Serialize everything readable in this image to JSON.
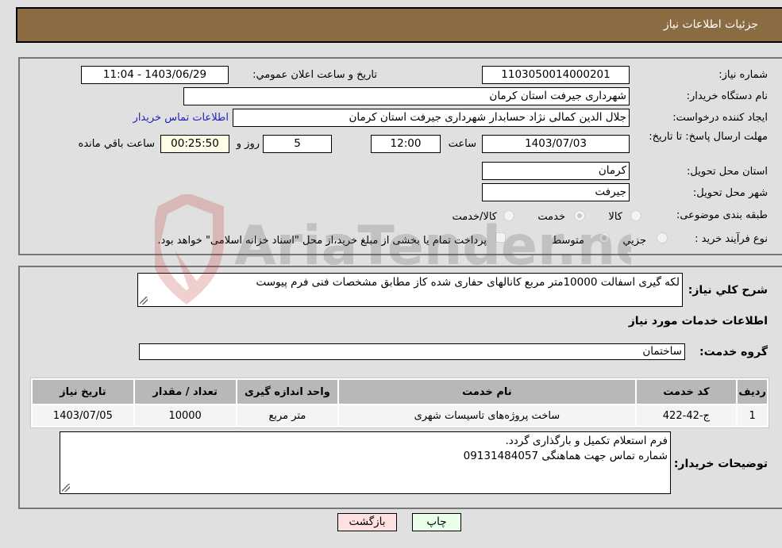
{
  "header": {
    "title": "جزئیات اطلاعات نیاز"
  },
  "form": {
    "need_number": {
      "label": "شماره نیاز:",
      "value": "1103050014000201"
    },
    "announce_datetime": {
      "label": "تاریخ و ساعت اعلان عمومي:",
      "value": "1403/06/29 - 11:04"
    },
    "buyer_org": {
      "label": "نام دستگاه خریدار:",
      "value": "شهرداری جیرفت استان کرمان"
    },
    "requester": {
      "label": "ایجاد کننده درخواست:",
      "value": "جلال الدین کمالی نژاد حسابدار شهرداری جیرفت استان کرمان"
    },
    "buyer_contact_link": "اطلاعات تماس خریدار",
    "deadline": {
      "label": "مهلت ارسال پاسخ: تا تاریخ:",
      "date": "1403/07/03",
      "time_label": "ساعت",
      "time": "12:00",
      "days": "5",
      "days_label": "روز و",
      "remaining": "00:25:50",
      "remaining_label": "ساعت باقي مانده"
    },
    "province": {
      "label": "استان محل تحویل:",
      "value": "کرمان"
    },
    "city": {
      "label": "شهر محل تحویل:",
      "value": "جیرفت"
    },
    "category": {
      "label": "طبقه بندی موضوعی:",
      "options": [
        "کالا",
        "خدمت",
        "کالا/خدمت"
      ],
      "selected": "خدمت"
    },
    "purchase_type": {
      "label": "نوع فرآیند خرید :",
      "options": [
        "جزيي",
        "متوسط"
      ],
      "selected": "متوسط",
      "treasury_note": "پرداخت تمام یا بخشی از مبلغ خرید،از محل \"اسناد خزانه اسلامی\" خواهد بود."
    }
  },
  "details": {
    "summary_label": "شرح كلي نياز:",
    "summary_value": "لکه گیری اسفالت 10000متر مربع کانالهای حفاری شده کاز مطابق مشخصات فنی فرم پیوست",
    "services_heading": "اطلاعات خدمات مورد نیاز",
    "service_group_label": "گروه خدمت:",
    "service_group_value": "ساختمان",
    "table": {
      "headers": [
        "ردیف",
        "کد خدمت",
        "نام خدمت",
        "واحد اندازه گیری",
        "تعداد / مقدار",
        "تاریخ نیاز"
      ],
      "rows": [
        [
          "1",
          "ج-42-422",
          "ساخت پروژه‌های تاسیسات شهری",
          "متر مربع",
          "10000",
          "1403/07/05"
        ]
      ]
    },
    "buyer_notes_label": "توضیحات خریدار:",
    "buyer_notes_lines": [
      "فرم استعلام تکمیل و بارگذاری گردد.",
      "شماره تماس جهت هماهنگی 09131484057"
    ]
  },
  "buttons": {
    "print": "چاپ",
    "back": "بازگشت"
  },
  "watermark": {
    "text": "AriaTender.neT"
  },
  "colors": {
    "header_bg": "#8b6b41",
    "print_bg": "#eaffea",
    "back_bg": "#ffe0e0",
    "link": "#2020c0"
  }
}
